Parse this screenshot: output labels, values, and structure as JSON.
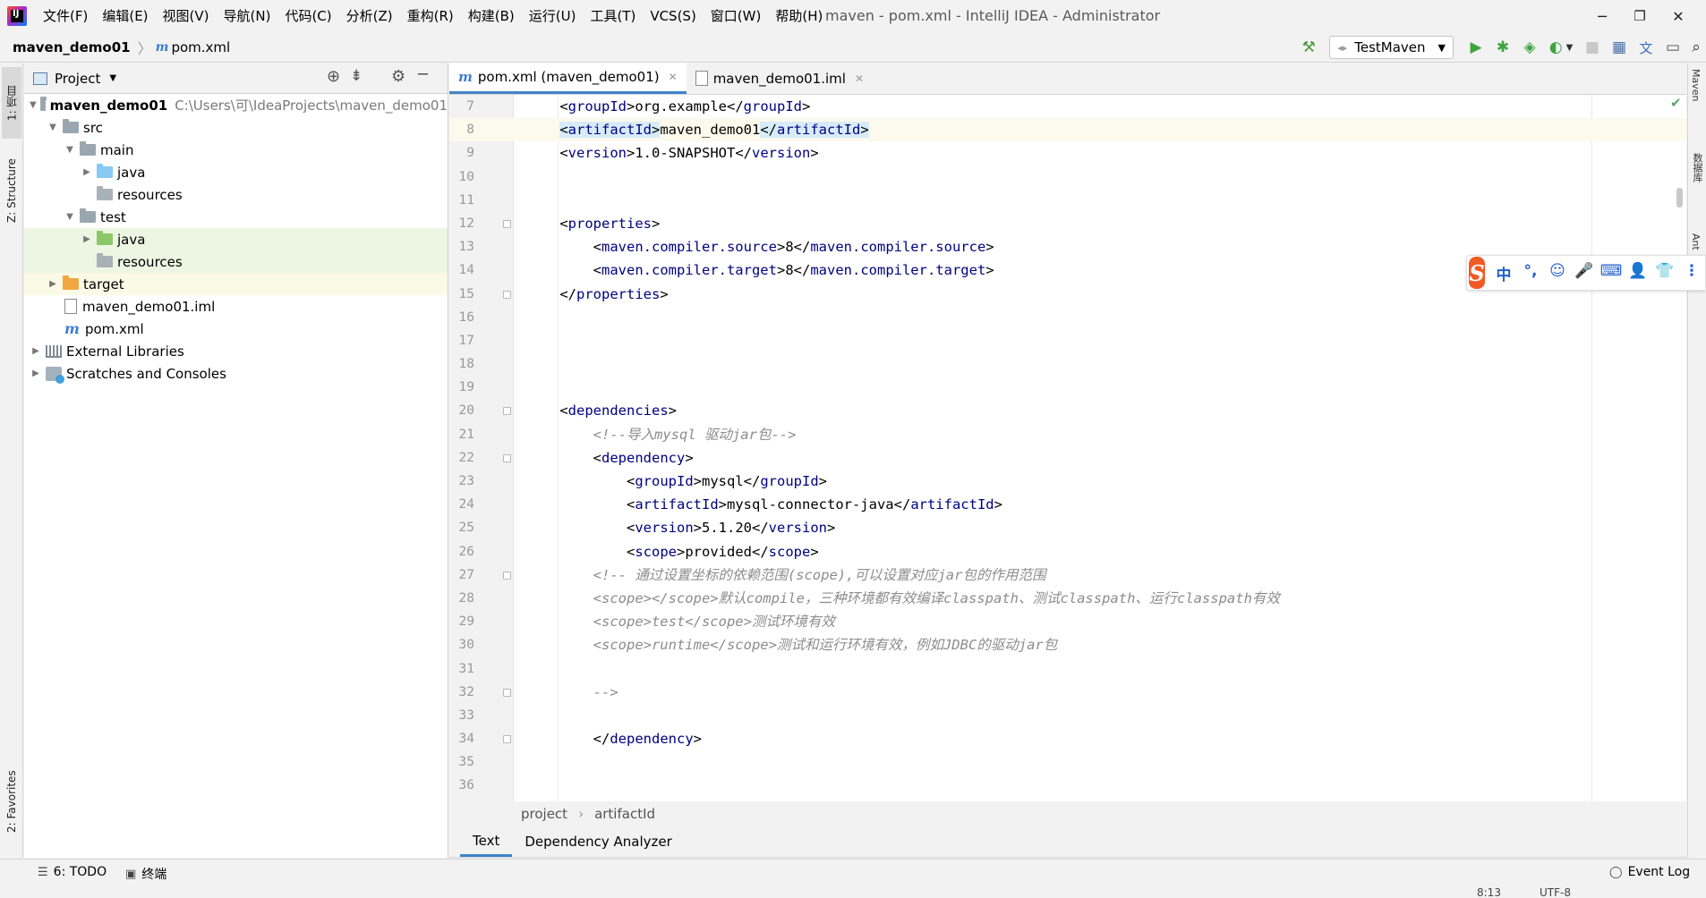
{
  "window": {
    "title": "maven - pom.xml - IntelliJ IDEA - Administrator",
    "logo_text": "IJ",
    "minimize": "─",
    "restore": "❐",
    "close": "✕"
  },
  "menu": [
    "文件(F)",
    "编辑(E)",
    "视图(V)",
    "导航(N)",
    "代码(C)",
    "分析(Z)",
    "重构(R)",
    "构建(B)",
    "运行(U)",
    "工具(T)",
    "VCS(S)",
    "窗口(W)",
    "帮助(H)"
  ],
  "nav": {
    "project": "maven_demo01",
    "file": "pom.xml",
    "file_icon": "m",
    "separator": "〉"
  },
  "toolbar": {
    "run_config": "TestMaven",
    "icons": [
      "build-hammer-icon",
      "run-icon",
      "debug-icon",
      "coverage-icon",
      "profile-icon",
      "stop-icon",
      "project-structure-icon",
      "translate-icon",
      "terminal-icon",
      "search-icon"
    ]
  },
  "left_stripe": {
    "project_tab": "1: 项目",
    "structure_tab": "Z: Structure",
    "favorites_tab": "2: Favorites"
  },
  "project_panel": {
    "title": "Project",
    "tree": [
      {
        "label": "maven_demo01",
        "hint": "C:\\Users\\可\\IdeaProjects\\maven_demo01",
        "depth": 0,
        "arrow": "▼",
        "icon": "module-folder",
        "bold": true
      },
      {
        "label": "src",
        "depth": 1,
        "arrow": "▼",
        "icon": "folder"
      },
      {
        "label": "main",
        "depth": 2,
        "arrow": "▼",
        "icon": "folder"
      },
      {
        "label": "java",
        "depth": 3,
        "arrow": "▶",
        "icon": "source-folder"
      },
      {
        "label": "resources",
        "depth": 3,
        "arrow": "",
        "icon": "resources-folder"
      },
      {
        "label": "test",
        "depth": 2,
        "arrow": "▼",
        "icon": "folder"
      },
      {
        "label": "java",
        "depth": 3,
        "arrow": "▶",
        "icon": "test-folder",
        "highlight": "green"
      },
      {
        "label": "resources",
        "depth": 3,
        "arrow": "",
        "icon": "test-resources-folder",
        "highlight": "green"
      },
      {
        "label": "target",
        "depth": 1,
        "arrow": "▶",
        "icon": "excluded-folder",
        "highlight": "yellow"
      },
      {
        "label": "maven_demo01.iml",
        "depth": 1,
        "arrow": "",
        "icon": "iml-file"
      },
      {
        "label": "pom.xml",
        "depth": 1,
        "arrow": "",
        "icon": "maven-file"
      },
      {
        "label": "External Libraries",
        "depth": 0,
        "arrow": "▶",
        "icon": "libraries"
      },
      {
        "label": "Scratches and Consoles",
        "depth": 0,
        "arrow": "▶",
        "icon": "scratches"
      }
    ]
  },
  "editor": {
    "tabs": [
      {
        "label": "pom.xml (maven_demo01)",
        "icon": "m",
        "active": true
      },
      {
        "label": "maven_demo01.iml",
        "icon": "iml",
        "active": false
      }
    ],
    "lines": [
      {
        "n": "7",
        "code": "    <groupId>org.example</groupId>"
      },
      {
        "n": "8",
        "code": "    <artifactId>maven_demo01</artifactId>",
        "current": true
      },
      {
        "n": "9",
        "code": "    <version>1.0-SNAPSHOT</version>"
      },
      {
        "n": "10",
        "code": ""
      },
      {
        "n": "11",
        "code": ""
      },
      {
        "n": "12",
        "code": "    <properties>",
        "fold": true
      },
      {
        "n": "13",
        "code": "        <maven.compiler.source>8</maven.compiler.source>"
      },
      {
        "n": "14",
        "code": "        <maven.compiler.target>8</maven.compiler.target>"
      },
      {
        "n": "15",
        "code": "    </properties>",
        "fold": true
      },
      {
        "n": "16",
        "code": ""
      },
      {
        "n": "17",
        "code": ""
      },
      {
        "n": "18",
        "code": ""
      },
      {
        "n": "19",
        "code": ""
      },
      {
        "n": "20",
        "code": "    <dependencies>",
        "fold": true
      },
      {
        "n": "21",
        "code": "        <!--导入mysql 驱动jar包-->",
        "comment": true
      },
      {
        "n": "22",
        "code": "        <dependency>",
        "fold": true
      },
      {
        "n": "23",
        "code": "            <groupId>mysql</groupId>"
      },
      {
        "n": "24",
        "code": "            <artifactId>mysql-connector-java</artifactId>"
      },
      {
        "n": "25",
        "code": "            <version>5.1.20</version>"
      },
      {
        "n": "26",
        "code": "            <scope>provided</scope>"
      },
      {
        "n": "27",
        "code": "        <!-- 通过设置坐标的依赖范围(scope),可以设置对应jar包的作用范围",
        "comment": true,
        "fold": true
      },
      {
        "n": "28",
        "code": "        <scope></scope>默认compile，三种环境都有效编译classpath、测试classpath、运行classpath有效",
        "comment": true
      },
      {
        "n": "29",
        "code": "        <scope>test</scope>测试环境有效",
        "comment": true
      },
      {
        "n": "30",
        "code": "        <scope>runtime</scope>测试和运行环境有效，例如JDBC的驱动jar包",
        "comment": true
      },
      {
        "n": "31",
        "code": ""
      },
      {
        "n": "32",
        "code": "        -->",
        "comment": true,
        "fold": true
      },
      {
        "n": "33",
        "code": ""
      },
      {
        "n": "34",
        "code": "        </dependency>",
        "fold": true
      },
      {
        "n": "35",
        "code": ""
      },
      {
        "n": "36",
        "code": ""
      }
    ],
    "breadcrumbs": [
      "project",
      "artifactId"
    ],
    "bottom_tabs": [
      {
        "label": "Text",
        "active": true
      },
      {
        "label": "Dependency Analyzer",
        "active": false
      }
    ]
  },
  "right_stripe": [
    "Maven",
    "数据库",
    "Ant"
  ],
  "ime_bar": {
    "logo": "S",
    "items": [
      "中",
      "°,",
      "☺",
      "🎤",
      "⌨",
      "👤",
      "👕",
      "⋮"
    ]
  },
  "statusbar": {
    "todo": "6: TODO",
    "terminal": "终端",
    "event_log": "Event Log",
    "position": "8:13",
    "encoding": "UTF-8"
  }
}
